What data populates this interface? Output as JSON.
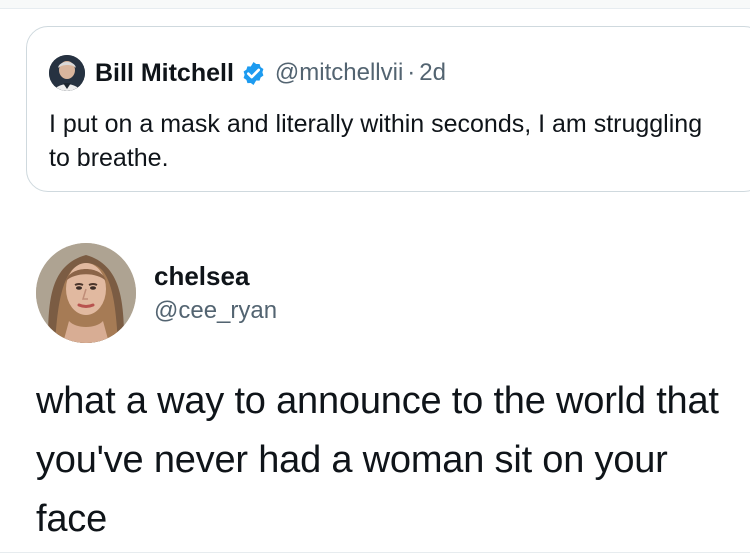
{
  "quoted_tweet": {
    "display_name": "Bill Mitchell",
    "handle": "@mitchellvii",
    "separator": "·",
    "time": "2d",
    "text": "I put on a mask and literally within seconds, I am struggling to breathe.",
    "verified": true,
    "icons": {
      "avatar": "profile-photo",
      "badge": "verified-icon"
    }
  },
  "tweet": {
    "display_name": "chelsea",
    "handle": "@cee_ryan",
    "text": "what a way to announce to the world that you've never had a woman sit on your face",
    "icons": {
      "avatar": "profile-photo"
    }
  },
  "colors": {
    "text_primary": "#0f1419",
    "text_secondary": "#536471",
    "border": "#cfd9de",
    "verified_blue": "#1d9bf0",
    "background": "#ffffff"
  }
}
